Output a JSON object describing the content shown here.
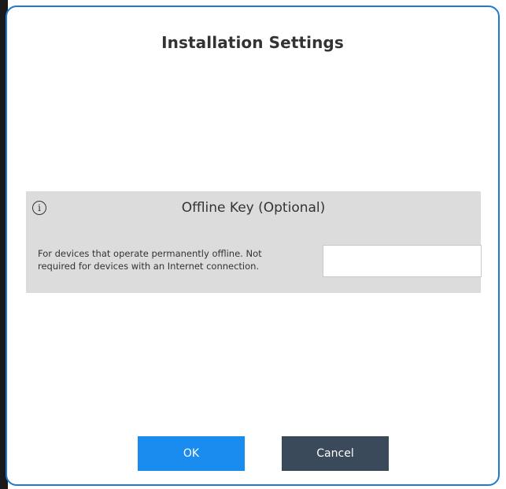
{
  "dialog": {
    "title": "Installation Settings"
  },
  "offline_key": {
    "info_icon": "info-circle-icon",
    "info_glyph": "i",
    "title": "Offline Key (Optional)",
    "description_line1": "For devices that operate permanently offline. Not",
    "description_line2": "required for devices with an Internet connection.",
    "input_value": ""
  },
  "buttons": {
    "ok_label": "OK",
    "cancel_label": "Cancel"
  },
  "colors": {
    "accent": "#1a8cf0",
    "border": "#1e7ad0",
    "cancel": "#3b4a5a",
    "panel": "#dcdcdc"
  }
}
